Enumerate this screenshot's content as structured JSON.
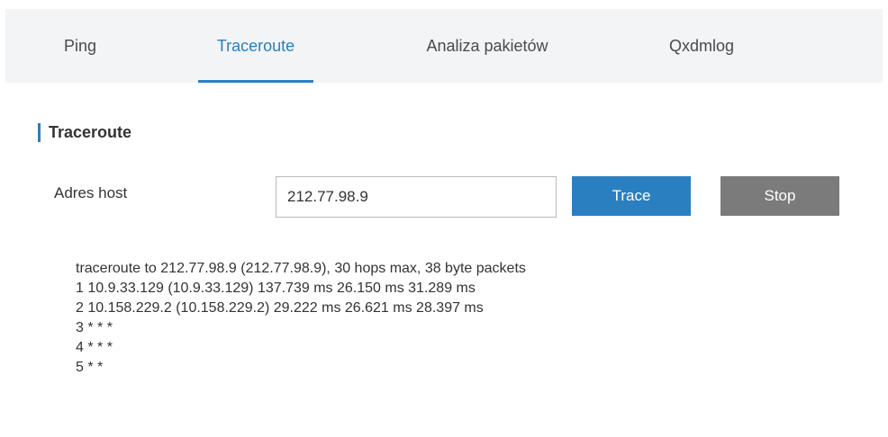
{
  "tabs": [
    {
      "label": "Ping",
      "active": false
    },
    {
      "label": "Traceroute",
      "active": true
    },
    {
      "label": "Analiza pakietów",
      "active": false
    },
    {
      "label": "Qxdmlog",
      "active": false
    }
  ],
  "section": {
    "title": "Traceroute"
  },
  "form": {
    "host_label": "Adres host",
    "host_value": "212.77.98.9",
    "trace_label": "Trace",
    "stop_label": "Stop"
  },
  "output": {
    "lines": [
      "traceroute to 212.77.98.9 (212.77.98.9), 30 hops max, 38 byte packets",
      "1 10.9.33.129 (10.9.33.129) 137.739 ms 26.150 ms 31.289 ms",
      "2 10.158.229.2 (10.158.229.2) 29.222 ms 26.621 ms 28.397 ms",
      "3 * * *",
      "4 * * *",
      "5 * *"
    ]
  },
  "colors": {
    "accent": "#2a7fc1",
    "stop_button": "#7b7b7b",
    "tab_bar_bg": "#f3f4f6"
  }
}
